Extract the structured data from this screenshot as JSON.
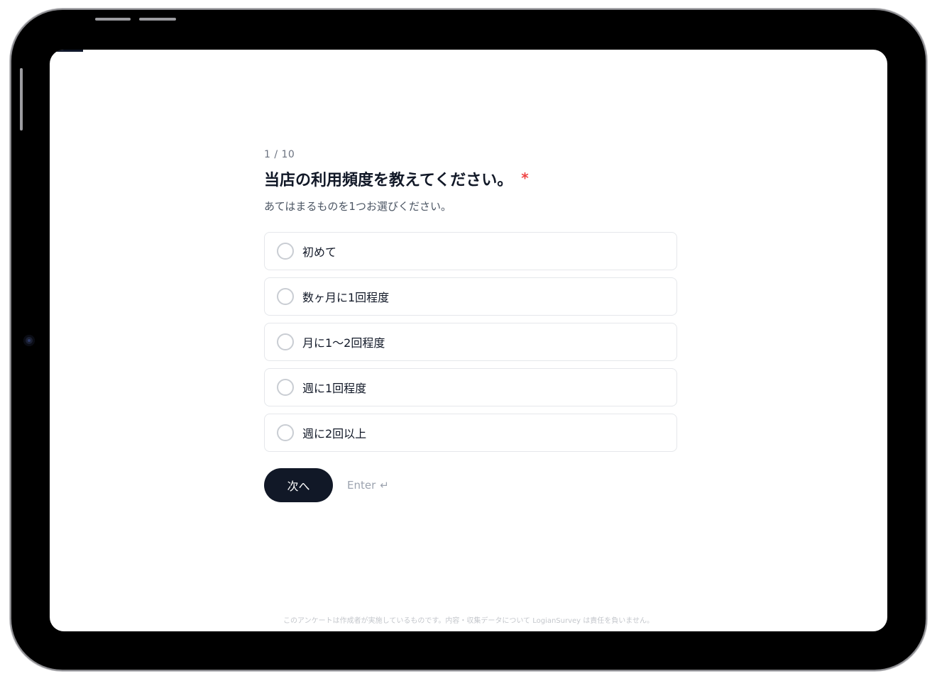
{
  "survey": {
    "progress_fraction": 0.1,
    "counter": "1 / 10",
    "question": {
      "title": "当店の利用頻度を教えてください。",
      "required_mark": "*",
      "hint": "あてはまるものを1つお選びください。"
    },
    "options": [
      {
        "label": "初めて"
      },
      {
        "label": "数ヶ月に1回程度"
      },
      {
        "label": "月に1〜2回程度"
      },
      {
        "label": "週に1回程度"
      },
      {
        "label": "週に2回以上"
      }
    ],
    "next_button_label": "次へ",
    "enter_hint": "Enter",
    "enter_icon": "↵",
    "footer": "このアンケートは作成者が実施しているものです。内容・収集データについて LogianSurvey は責任を負いません。"
  },
  "colors": {
    "accent": "#111827",
    "required": "#ef4444",
    "border": "#e5e7eb"
  },
  "icons": {
    "enter": "return-arrow-icon",
    "radio": "radio-circle-icon"
  }
}
